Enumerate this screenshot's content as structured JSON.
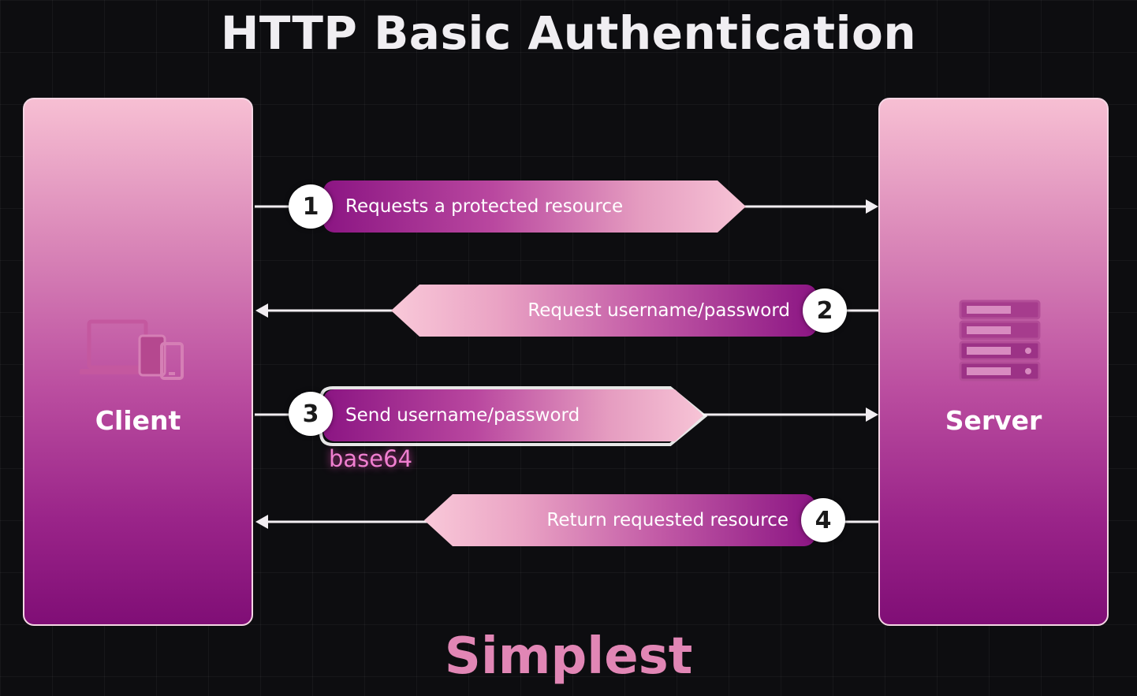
{
  "title": "HTTP Basic Authentication",
  "client": {
    "label": "Client",
    "icon": "devices-icon"
  },
  "server": {
    "label": "Server",
    "icon": "server-rack-icon"
  },
  "steps": [
    {
      "number": "1",
      "label": "Requests a protected resource",
      "direction": "client-to-server"
    },
    {
      "number": "2",
      "label": "Request username/password",
      "direction": "server-to-client"
    },
    {
      "number": "3",
      "label": "Send username/password",
      "direction": "client-to-server",
      "note": "base64"
    },
    {
      "number": "4",
      "label": "Return requested resource",
      "direction": "server-to-client"
    }
  ],
  "footer": "Simplest",
  "colors": {
    "background": "#0d0d10",
    "accent_dark": "#8b1583",
    "accent_light": "#f7c4d6",
    "note": "#f07fd0",
    "footer": "#e186b5"
  }
}
